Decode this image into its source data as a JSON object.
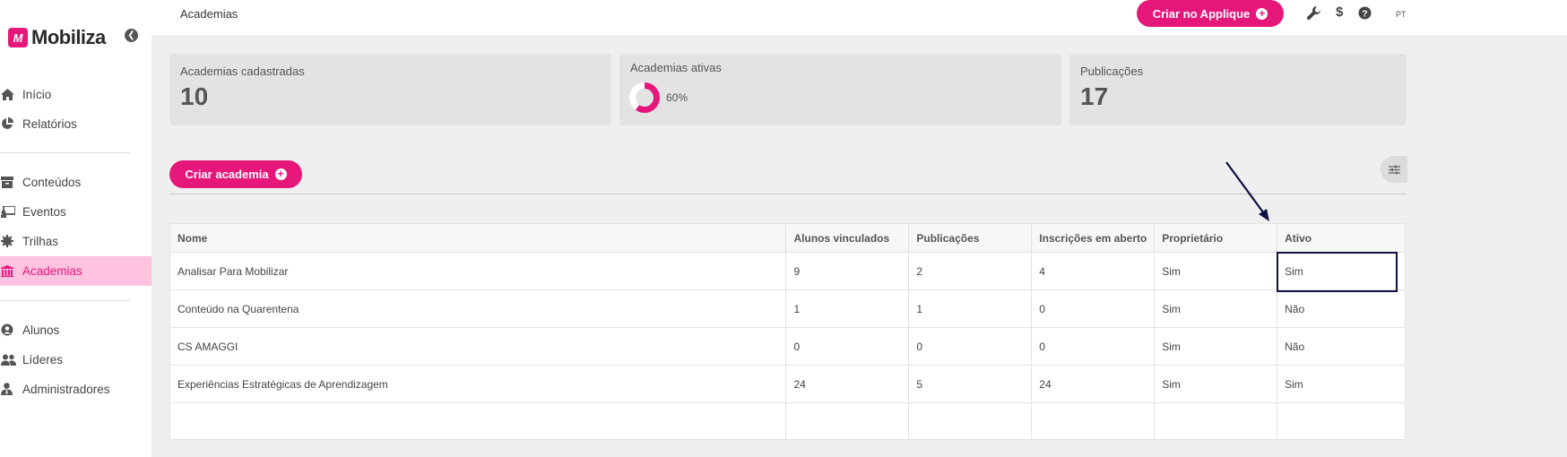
{
  "app": {
    "name": "Mobiliza",
    "logo_mark": "M"
  },
  "sidebar": {
    "items": [
      {
        "label": "Início",
        "icon": "home-icon"
      },
      {
        "label": "Relatórios",
        "icon": "chart-pie-icon"
      },
      {
        "label": "Conteúdos",
        "icon": "archive-icon"
      },
      {
        "label": "Eventos",
        "icon": "presentation-icon"
      },
      {
        "label": "Trilhas",
        "icon": "gear-badge-icon"
      },
      {
        "label": "Academias",
        "icon": "institution-icon",
        "active": true
      },
      {
        "label": "Alunos",
        "icon": "user-circle-icon"
      },
      {
        "label": "Líderes",
        "icon": "users-icon"
      },
      {
        "label": "Administradores",
        "icon": "user-tie-icon"
      }
    ]
  },
  "topbar": {
    "breadcrumb": "Academias",
    "create_applique_label": "Criar no Applique",
    "icons": [
      "wrench-icon",
      "dollar-icon",
      "help-icon"
    ],
    "lang": "PT"
  },
  "stats": {
    "cadastradas": {
      "label": "Academias cadastradas",
      "value": "10"
    },
    "ativas": {
      "label": "Academias ativas",
      "percent_text": "60%",
      "percent": 60
    },
    "publicacoes": {
      "label": "Publicações",
      "value": "17"
    }
  },
  "actions": {
    "create_label": "Criar academia"
  },
  "table": {
    "headers": [
      "Nome",
      "Alunos vinculados",
      "Publicações",
      "Inscrições em aberto",
      "Proprietário",
      "Ativo"
    ],
    "rows": [
      [
        "Analisar Para Mobilizar",
        "9",
        "2",
        "4",
        "Sim",
        "Sim"
      ],
      [
        "Conteúdo na Quarentena",
        "1",
        "1",
        "0",
        "Sim",
        "Não"
      ],
      [
        "CS AMAGGI",
        "0",
        "0",
        "0",
        "Sim",
        "Não"
      ],
      [
        "Experiências Estratégicas de Aprendizagem",
        "24",
        "5",
        "24",
        "Sim",
        "Sim"
      ]
    ]
  },
  "colors": {
    "accent": "#e6177a",
    "active_bg": "#ffc2df",
    "annotation": "#0e1240"
  }
}
